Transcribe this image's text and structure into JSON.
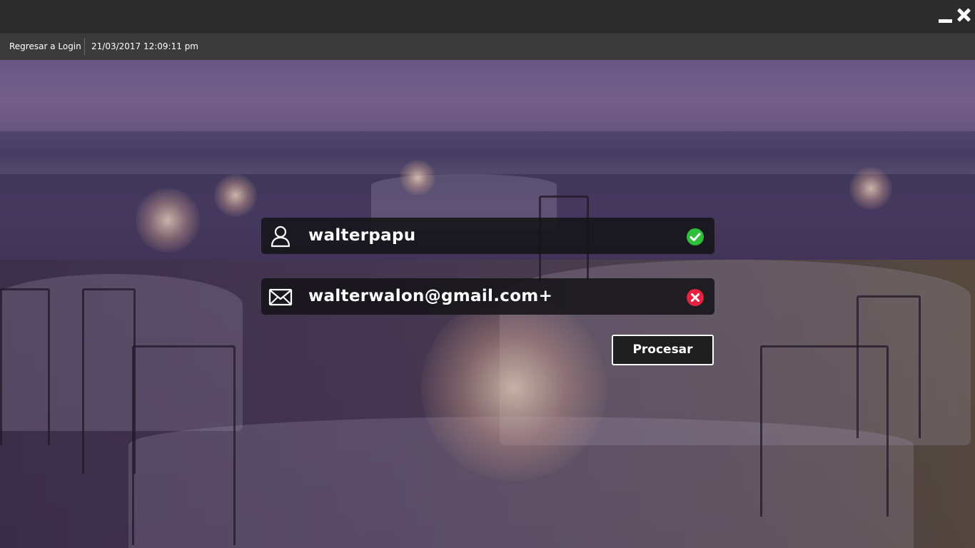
{
  "window": {
    "minimize_icon": "minimize-icon",
    "close_icon": "close-icon"
  },
  "toolbar": {
    "back_label": "Regresar a Login",
    "datetime": "21/03/2017 12:09:11 pm"
  },
  "form": {
    "username": {
      "icon": "user-icon",
      "value": "walterpapu",
      "status": "valid",
      "status_icon": "check-circle-icon",
      "status_color": "#2fbf3a"
    },
    "email": {
      "icon": "envelope-icon",
      "value": "walterwalon@gmail.com+",
      "status": "invalid",
      "status_icon": "x-circle-icon",
      "status_color": "#e62240"
    },
    "submit_label": "Procesar"
  },
  "colors": {
    "title_bar": "#2c2c2c",
    "sub_bar": "#3b3b3b",
    "field_bg": "#141416",
    "overlay_tint": "#6e5b86"
  }
}
